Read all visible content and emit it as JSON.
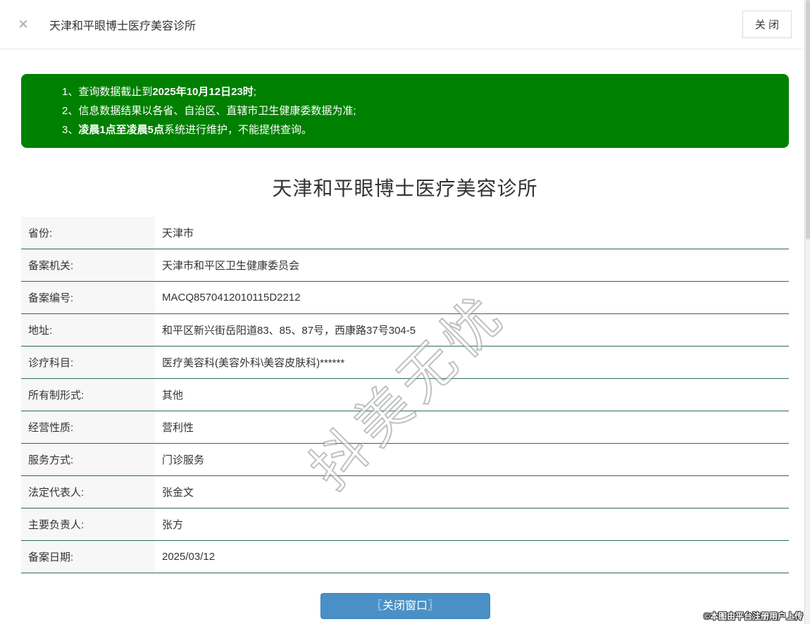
{
  "header": {
    "close_icon": "×",
    "title": "天津和平眼博士医疗美容诊所",
    "close_button_label": "关 闭"
  },
  "notice": {
    "bg_color": "#008000",
    "items": [
      {
        "pre": "1、查询数据截止到",
        "bold": "2025年10月12日23时",
        "post": ";"
      },
      {
        "pre": "2、信息数据结果以各省、自治区、直辖市卫生健康委数据为准;",
        "bold": "",
        "post": ""
      },
      {
        "pre": "3、",
        "bold": "凌晨1点至凌晨5点",
        "post": "系统进行维护，不能提供查询。"
      }
    ]
  },
  "main": {
    "title": "天津和平眼博士医疗美容诊所"
  },
  "table": {
    "border_color": "#2e6d52",
    "rows": [
      {
        "label": "省份:",
        "value": "天津市"
      },
      {
        "label": "备案机关:",
        "value": "天津市和平区卫生健康委员会"
      },
      {
        "label": "备案编号:",
        "value": "MACQ8570412010115D2212"
      },
      {
        "label": "地址:",
        "value": "和平区新兴街岳阳道83、85、87号，西康路37号304-5"
      },
      {
        "label": "诊疗科目:",
        "value": "医疗美容科(美容外科\\美容皮肤科)******"
      },
      {
        "label": "所有制形式:",
        "value": "其他"
      },
      {
        "label": "经营性质:",
        "value": "营利性"
      },
      {
        "label": "服务方式:",
        "value": "门诊服务"
      },
      {
        "label": "法定代表人:",
        "value": "张金文"
      },
      {
        "label": "主要负责人:",
        "value": "张方"
      },
      {
        "label": "备案日期:",
        "value": "2025/03/12"
      }
    ]
  },
  "footer": {
    "close_window_button": "〖关闭窗口〗",
    "button_color": "#4a90c6",
    "copyright": "©本图由平台注册用户上传"
  },
  "watermark": {
    "text": "抖美无忧"
  }
}
